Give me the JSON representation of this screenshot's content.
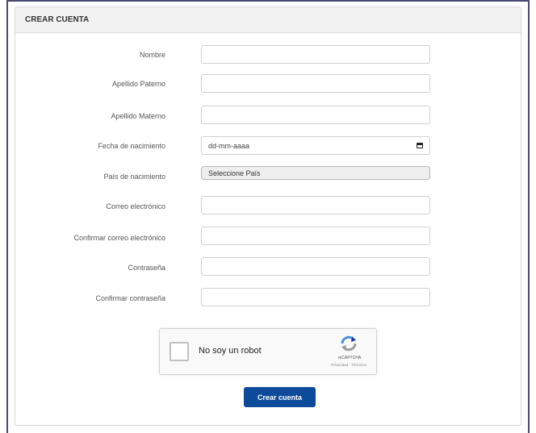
{
  "header": {
    "title": "CREAR CUENTA"
  },
  "form": {
    "nombre_label": "Nombre",
    "apellido_paterno_label": "Apellido Paterno",
    "apellido_materno_label": "Apellido Materno",
    "fecha_label": "Fecha de nacimiento",
    "fecha_placeholder": "dd-mm-aaaa",
    "pais_label": "País de nacimiento",
    "pais_selected": "Seleccione País",
    "correo_label": "Correo electrónico",
    "confirmar_correo_label": "Confirmar correo electrónico",
    "contrasena_label": "Contraseña",
    "confirmar_contrasena_label": "Confirmar contraseña",
    "submit_label": "Crear cuenta"
  },
  "captcha": {
    "label": "No soy un robot",
    "brand": "reCAPTCHA",
    "links": "Privacidad - Términos",
    "logo_icon": "recaptcha-icon"
  },
  "colors": {
    "primary_button": "#0d4a99",
    "frame_border": "#4a4872"
  }
}
